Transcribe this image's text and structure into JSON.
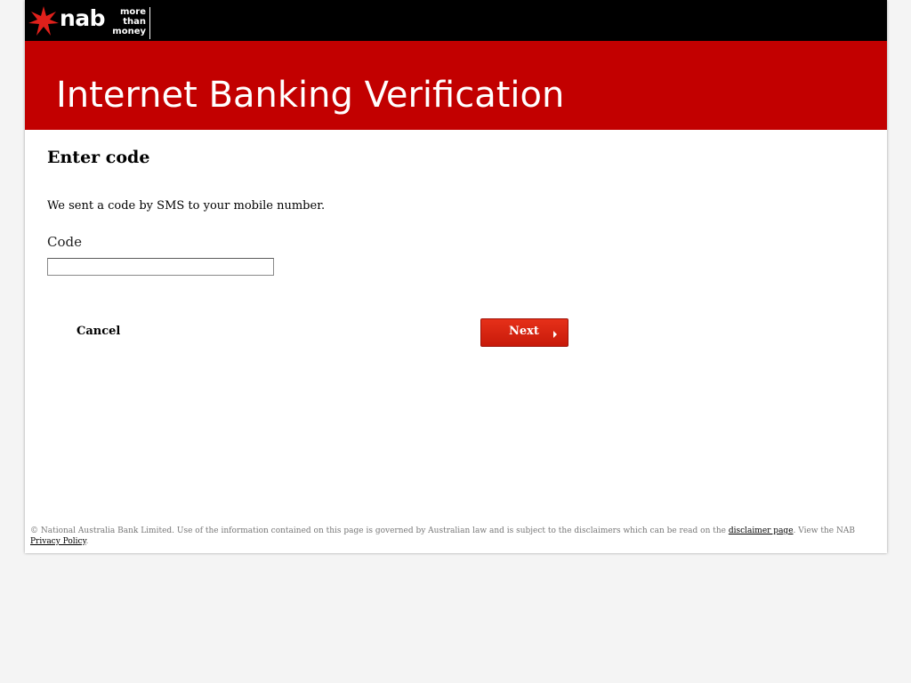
{
  "brand": {
    "name": "nab",
    "tagline": [
      "more",
      "than",
      "money"
    ]
  },
  "banner": {
    "title": "Internet Banking Verification"
  },
  "form": {
    "heading": "Enter code",
    "message": "We sent a code by SMS to your mobile number.",
    "code_label": "Code",
    "code_value": "",
    "cancel_label": "Cancel",
    "next_label": "Next"
  },
  "footer": {
    "text_before": "© National Australia Bank Limited. Use of the information contained on this page is governed by Australian law and is subject to the disclaimers which can be read on the ",
    "disclaimer_link": "disclaimer page",
    "text_middle": ". View the NAB ",
    "privacy_link": "Privacy Policy",
    "text_after": "."
  },
  "colors": {
    "header_bg": "#000000",
    "banner_bg": "#c20000",
    "accent": "#e63019",
    "page_bg": "#f4f4f4"
  },
  "icons": {
    "logo_star": "nab-star-icon",
    "next_arrow": "arrow-right-icon"
  }
}
